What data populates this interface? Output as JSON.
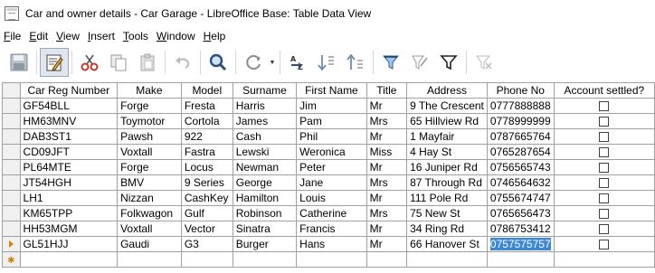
{
  "window": {
    "title": "Car and owner details - Car Garage - LibreOffice Base: Table Data View"
  },
  "menu": {
    "items": [
      {
        "label": "File",
        "ul": "F",
        "rest": "ile"
      },
      {
        "label": "Edit",
        "ul": "E",
        "rest": "dit"
      },
      {
        "label": "View",
        "ul": "V",
        "rest": "iew"
      },
      {
        "label": "Insert",
        "ul": "I",
        "rest": "nsert"
      },
      {
        "label": "Tools",
        "ul": "T",
        "rest": "ools"
      },
      {
        "label": "Window",
        "ul": "W",
        "rest": "indow"
      },
      {
        "label": "Help",
        "ul": "H",
        "rest": "elp"
      }
    ]
  },
  "toolbar": {
    "icons": [
      "save-icon",
      "edit-data-icon",
      "cut-icon",
      "copy-icon",
      "paste-icon",
      "undo-icon",
      "find-icon",
      "refresh-icon",
      "sort-icon",
      "sort-ascending-icon",
      "sort-descending-icon",
      "autofilter-icon",
      "standard-filter-icon",
      "apply-filter-icon",
      "reset-filter-icon"
    ]
  },
  "table": {
    "columns": [
      "Car Reg Number",
      "Make",
      "Model",
      "Surname",
      "First Name",
      "Title",
      "Address",
      "Phone No",
      "Account settled?"
    ],
    "rows": [
      [
        "GF54BLL",
        "Forge",
        "Fresta",
        "Harris",
        "Jim",
        "Mr",
        "9 The Crescent",
        "0777888888"
      ],
      [
        "HM63MNV",
        "Toymotor",
        "Cortola",
        "James",
        "Pam",
        "Mrs",
        "65 Hillview Rd",
        "0778999999"
      ],
      [
        "DAB3ST1",
        "Pawsh",
        "922",
        "Cash",
        "Phil",
        "Mr",
        "1 Mayfair",
        "0787665764"
      ],
      [
        "CD09JFT",
        "Voxtall",
        "Fastra",
        "Lewski",
        "Weronica",
        "Miss",
        "4 Hay St",
        "0765287654"
      ],
      [
        "PL64MTE",
        "Forge",
        "Locus",
        "Newman",
        "Peter",
        "Mr",
        "16 Juniper Rd",
        "0756565743"
      ],
      [
        "JT54HGH",
        "BMV",
        "9 Series",
        "George",
        "Jane",
        "Mrs",
        "87 Through Rd",
        "0746564632"
      ],
      [
        "LH1",
        "Nizzan",
        "CashKey",
        "Hamilton",
        "Louis",
        "Mr",
        "111 Pole Rd",
        "0755674747"
      ],
      [
        "KM65TPP",
        "Folkwagon",
        "Gulf",
        "Robinson",
        "Catherine",
        "Mrs",
        "75 New St",
        "0765656473"
      ],
      [
        "HH53MGM",
        "Voxtall",
        "Vector",
        "Sinatra",
        "Francis",
        "Mr",
        "34 Ring Rd",
        "0786753412"
      ],
      [
        "GL51HJJ",
        "Gaudi",
        "G3",
        "Burger",
        "Hans",
        "Mr",
        "66 Hanover St",
        "0757575757"
      ]
    ],
    "account_settled": [
      false,
      false,
      false,
      false,
      false,
      false,
      false,
      false,
      false,
      false
    ],
    "current_row": 9,
    "selected_cell": "0757575757"
  }
}
